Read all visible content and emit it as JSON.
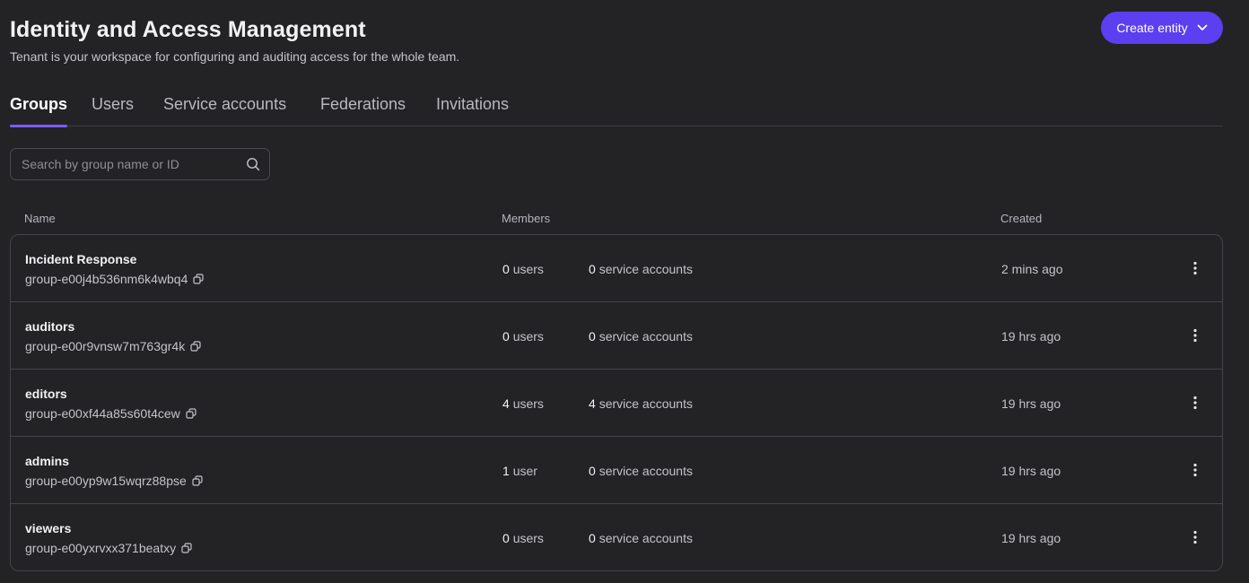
{
  "header": {
    "title": "Identity and Access Management",
    "subtitle": "Tenant is your workspace for configuring and auditing access for the whole team.",
    "create_button_label": "Create entity",
    "create_button_icon": "chevron-down-icon"
  },
  "colors": {
    "background": "#232326",
    "accent": "#5b3ff0",
    "tab_underline": "#7a5cff",
    "border": "#444449"
  },
  "tabs": [
    {
      "label": "Groups",
      "active": true
    },
    {
      "label": "Users",
      "active": false
    },
    {
      "label": "Service accounts",
      "active": false
    },
    {
      "label": "Federations",
      "active": false
    },
    {
      "label": "Invitations",
      "active": false
    }
  ],
  "search": {
    "placeholder": "Search by group name or ID",
    "value": "",
    "icon": "search-icon"
  },
  "table": {
    "columns": [
      "Name",
      "Members",
      "Created"
    ],
    "rows": [
      {
        "name": "Incident Response",
        "id": "group-e00j4b536nm6k4wbq4",
        "users_count": "0",
        "users_label": "users",
        "sa_count": "0",
        "sa_label": "service accounts",
        "created": "2 mins ago"
      },
      {
        "name": "auditors",
        "id": "group-e00r9vnsw7m763gr4k",
        "users_count": "0",
        "users_label": "users",
        "sa_count": "0",
        "sa_label": "service accounts",
        "created": "19 hrs ago"
      },
      {
        "name": "editors",
        "id": "group-e00xf44a85s60t4cew",
        "users_count": "4",
        "users_label": "users",
        "sa_count": "4",
        "sa_label": "service accounts",
        "created": "19 hrs ago"
      },
      {
        "name": "admins",
        "id": "group-e00yp9w15wqrz88pse",
        "users_count": "1",
        "users_label": "user",
        "sa_count": "0",
        "sa_label": "service accounts",
        "created": "19 hrs ago"
      },
      {
        "name": "viewers",
        "id": "group-e00yxrvxx371beatxy",
        "users_count": "0",
        "users_label": "users",
        "sa_count": "0",
        "sa_label": "service accounts",
        "created": "19 hrs ago"
      }
    ]
  }
}
